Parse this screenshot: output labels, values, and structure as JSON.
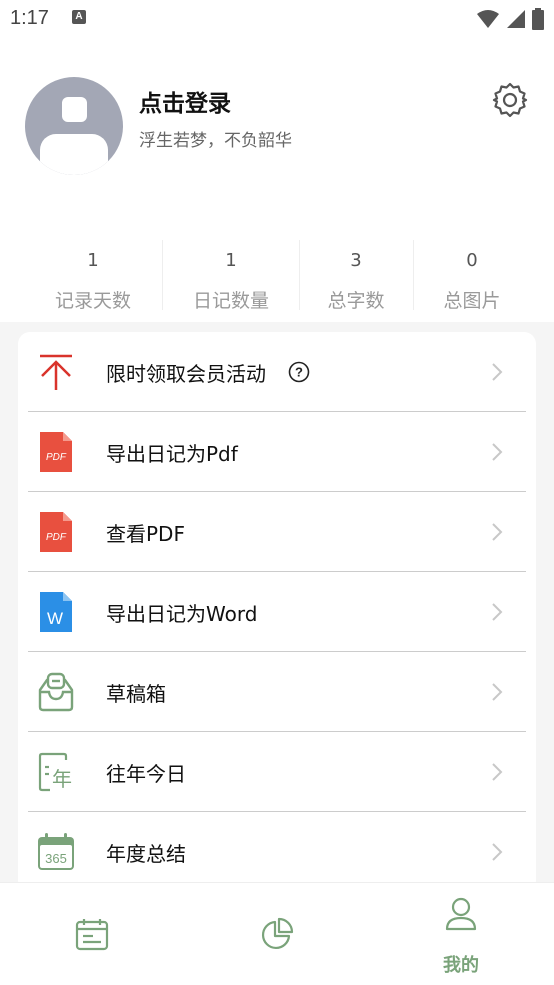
{
  "status_bar": {
    "time": "1:17",
    "notification_letter": "A"
  },
  "profile": {
    "login_label": "点击登录",
    "motto": "浮生若梦，不负韶华"
  },
  "stats": [
    {
      "value": "1",
      "label": "记录天数"
    },
    {
      "value": "1",
      "label": "日记数量"
    },
    {
      "value": "3",
      "label": "总字数"
    },
    {
      "value": "0",
      "label": "总图片"
    }
  ],
  "menu": [
    {
      "label": "限时领取会员活动",
      "icon": "arrow-up-icon"
    },
    {
      "label": "导出日记为Pdf",
      "icon": "pdf-file-icon"
    },
    {
      "label": "查看PDF",
      "icon": "pdf-file-icon"
    },
    {
      "label": "导出日记为Word",
      "icon": "word-file-icon"
    },
    {
      "label": "草稿箱",
      "icon": "drafts-inbox-icon"
    },
    {
      "label": "往年今日",
      "icon": "year-calendar-icon"
    },
    {
      "label": "年度总结",
      "icon": "calendar-365-icon"
    }
  ],
  "icon_text": {
    "pdf": "PDF",
    "word": "W",
    "year": "年",
    "days": "365"
  },
  "bottom_nav": {
    "active_label": "我的"
  },
  "colors": {
    "accent_green": "#7aa37a",
    "red_arrow": "#d9332b",
    "pdf_red": "#e8503f",
    "word_blue": "#2b8fe6",
    "avatar_gray": "#a3a7b5"
  }
}
